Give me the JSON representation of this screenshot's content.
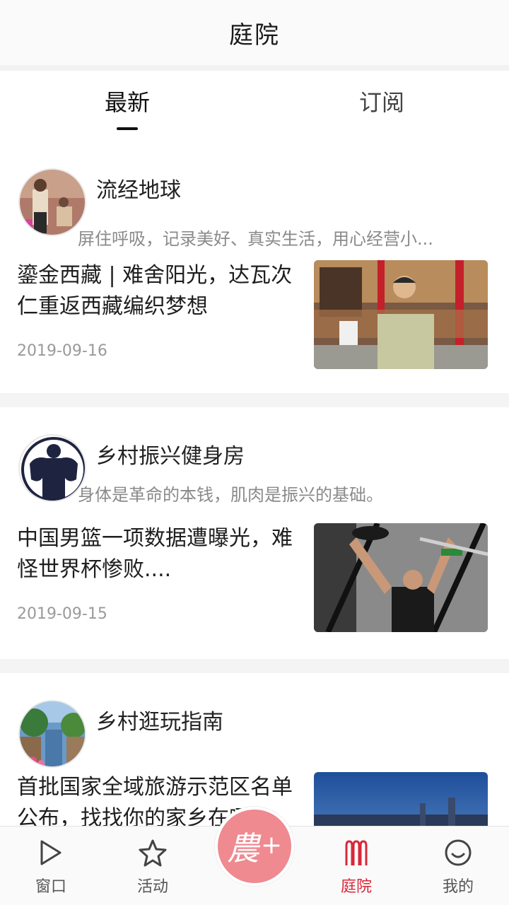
{
  "header": {
    "title": "庭院"
  },
  "tabs": [
    {
      "label": "最新",
      "active": true
    },
    {
      "label": "订阅",
      "active": false
    }
  ],
  "feed": [
    {
      "author": "流经地球",
      "description": "屏住呼吸，记录美好、真实生活，用心经营小...",
      "title": "鎏金西藏 | 难舍阳光，达瓦次仁重返西藏编织梦想",
      "date": "2019-09-16",
      "avatar_icon": "avatar-photo",
      "thumb_icon": "article-photo"
    },
    {
      "author": "乡村振兴健身房",
      "description": "身体是革命的本钱，肌肉是振兴的基础。",
      "title": "中国男篮一项数据遭曝光，难怪世界杯惨败....",
      "date": "2019-09-15",
      "avatar_icon": "avatar-bodybuilder",
      "thumb_icon": "article-photo"
    },
    {
      "author": "乡村逛玩指南",
      "description": "",
      "title": "首批国家全域旅游示范区名单公布，找找你的家乡在哪...",
      "date": "",
      "avatar_icon": "avatar-canal",
      "thumb_icon": "article-photo"
    }
  ],
  "tabbar": {
    "items": [
      {
        "label": "窗口",
        "icon": "play-icon"
      },
      {
        "label": "活动",
        "icon": "star-icon"
      },
      {
        "label": "庭院",
        "icon": "fence-icon",
        "active": true
      },
      {
        "label": "我的",
        "icon": "smile-icon"
      }
    ],
    "center_text": "農",
    "center_plus": "+"
  },
  "colors": {
    "accent": "#d8283a",
    "center_button": "#ee8a90"
  }
}
